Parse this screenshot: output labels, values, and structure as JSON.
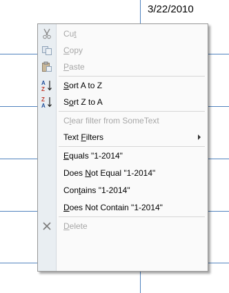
{
  "sheet": {
    "date_cell": "3/22/2010"
  },
  "menu": {
    "items": [
      {
        "pre": "Cu",
        "key": "t",
        "post": "",
        "enabled": false,
        "icon": "scissors-icon"
      },
      {
        "pre": "",
        "key": "C",
        "post": "opy",
        "enabled": false,
        "icon": "copy-icon"
      },
      {
        "pre": "",
        "key": "P",
        "post": "aste",
        "enabled": false,
        "icon": "paste-icon"
      },
      {
        "pre": "",
        "key": "S",
        "post": "ort A to Z",
        "enabled": true,
        "icon": "sort-a-to-z-icon"
      },
      {
        "pre": "S",
        "key": "o",
        "post": "rt Z to A",
        "enabled": true,
        "icon": "sort-z-to-a-icon"
      },
      {
        "pre": "C",
        "key": "l",
        "post": "ear filter from SomeText",
        "enabled": false,
        "icon": ""
      },
      {
        "pre": "Text ",
        "key": "F",
        "post": "ilters",
        "enabled": true,
        "icon": "",
        "submenu": true
      },
      {
        "pre": "",
        "key": "E",
        "post": "quals \"1-2014\"",
        "enabled": true,
        "icon": ""
      },
      {
        "pre": "Does ",
        "key": "N",
        "post": "ot Equal \"1-2014\"",
        "enabled": true,
        "icon": ""
      },
      {
        "pre": "Con",
        "key": "t",
        "post": "ains \"1-2014\"",
        "enabled": true,
        "icon": ""
      },
      {
        "pre": "",
        "key": "D",
        "post": "oes Not Contain \"1-2014\"",
        "enabled": true,
        "icon": ""
      },
      {
        "pre": "",
        "key": "D",
        "post": "elete",
        "enabled": false,
        "icon": "delete-x-icon"
      }
    ]
  }
}
